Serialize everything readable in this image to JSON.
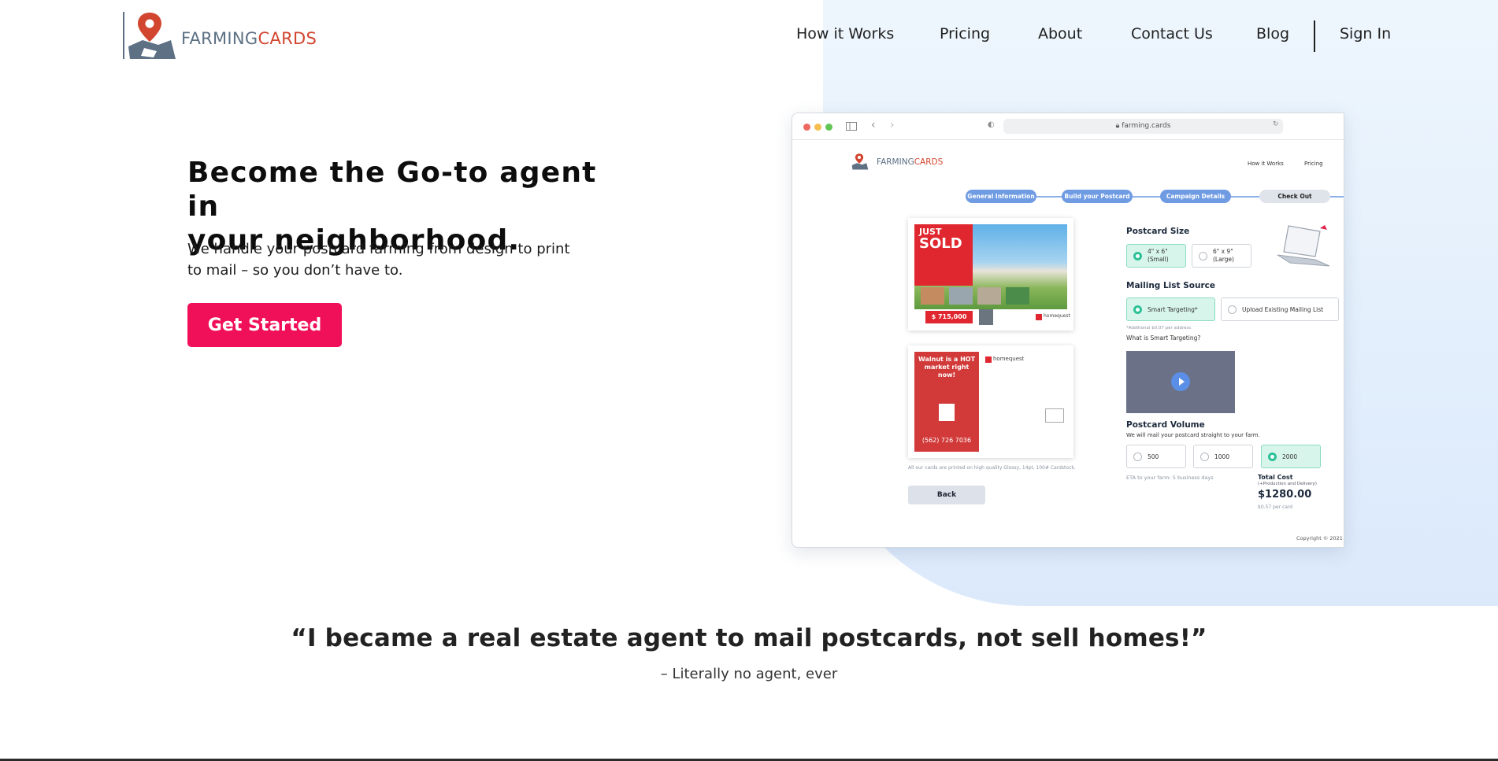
{
  "brand": {
    "logo_text_farm": "FARMING",
    "logo_text_cards": "CARDS",
    "colors": {
      "primary": "#f0105a",
      "logo_gray": "#5d7084",
      "logo_red": "#d2452f",
      "hero_bg": "#e3effc"
    }
  },
  "nav": {
    "items": [
      {
        "label": "How it Works"
      },
      {
        "label": "Pricing"
      },
      {
        "label": "About"
      },
      {
        "label": "Contact Us"
      },
      {
        "label": "Blog"
      }
    ],
    "sign_in": "Sign In"
  },
  "hero": {
    "headline_line1": "Become the Go-to agent in",
    "headline_line2": "your neighborhood.",
    "subtext_line1": "We handle your postcard farming from design to print",
    "subtext_line2": "to mail – so you don’t have to.",
    "cta_label": "Get Started"
  },
  "mockup": {
    "url": "farming.cards",
    "nav_items": [
      "How it Works",
      "Pricing"
    ],
    "steps": [
      "General Information",
      "Build your Postcard",
      "Campaign Details",
      "Check Out"
    ],
    "postcard_front": {
      "headline1": "JUST",
      "headline2": "SOLD",
      "price": "$ 715,000"
    },
    "postcard_back": {
      "headline": "Walnut is a HOT market right now!",
      "phone": "(562) 726 7036",
      "brand": "homequest"
    },
    "print_note": "All our cards are printed on high quality Glossy, 14pt, 100# Cardstock.",
    "back_label": "Back",
    "postcard_size": {
      "title": "Postcard Size",
      "options": [
        {
          "label": "4\" x 6\"",
          "sub": "(Small)",
          "selected": true
        },
        {
          "label": "6\" x 9\"",
          "sub": "(Large)",
          "selected": false
        }
      ]
    },
    "mailing_list": {
      "title": "Mailing List Source",
      "options": [
        {
          "label": "Smart Targeting*",
          "selected": true
        },
        {
          "label": "Upload Existing Mailing List",
          "selected": false
        }
      ],
      "note": "*Additional $0.07 per address",
      "question": "What is Smart Targeting?"
    },
    "volume": {
      "title": "Postcard Volume",
      "subtitle": "We will mail your postcard straight to your farm.",
      "options": [
        {
          "label": "500",
          "selected": false
        },
        {
          "label": "1000",
          "selected": false
        },
        {
          "label": "2000",
          "selected": true
        }
      ],
      "eta": "ETA to your farm: 5 business days"
    },
    "total": {
      "title": "Total Cost",
      "subtitle": "(+Production and Delivery)",
      "amount": "$1280.00",
      "per_card": "$0.57 per card"
    },
    "copyright": "Copyright © 2021"
  },
  "quote": {
    "text": "“I became a real estate agent to mail postcards, not sell homes!”",
    "attribution": "– Literally no agent, ever"
  }
}
